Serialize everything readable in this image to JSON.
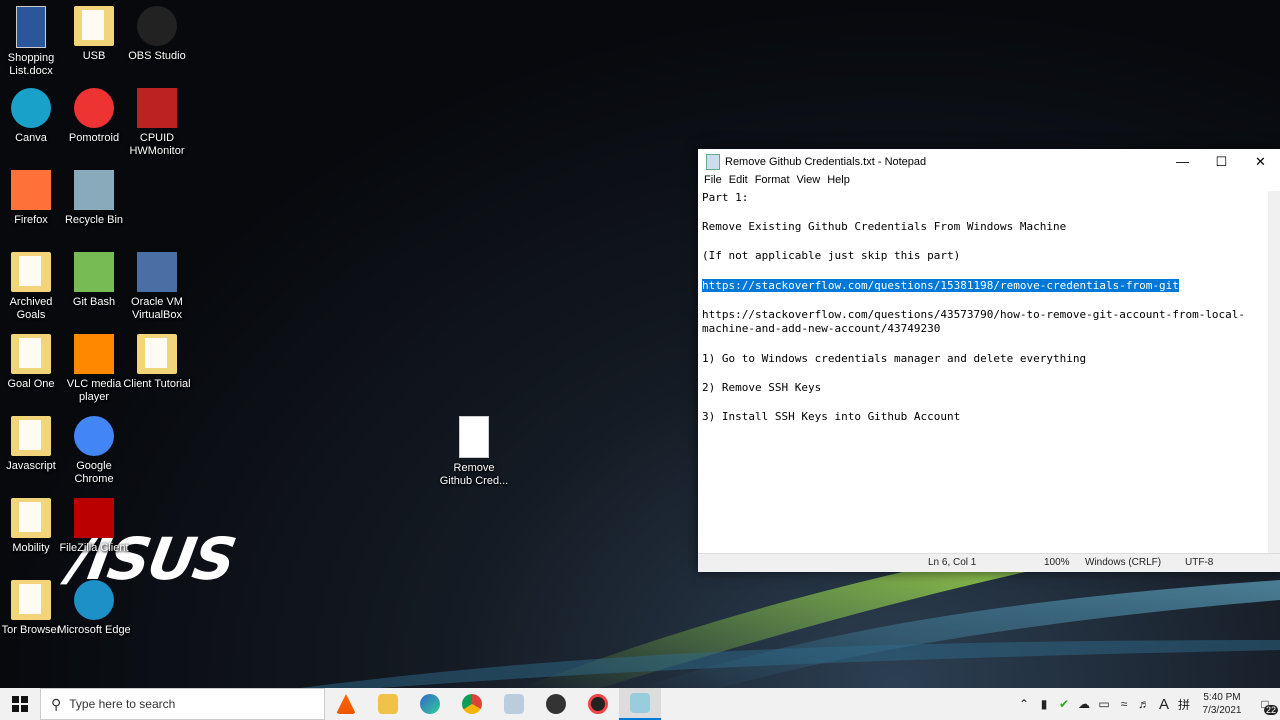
{
  "desktop_icons": [
    {
      "label": "Shopping List.docx"
    },
    {
      "label": "USB"
    },
    {
      "label": "OBS Studio"
    },
    {
      "label": "Canva"
    },
    {
      "label": "Pomotroid"
    },
    {
      "label": "CPUID HWMonitor"
    },
    {
      "label": "Firefox"
    },
    {
      "label": "Recycle Bin"
    },
    {
      "label": "Archived Goals"
    },
    {
      "label": "Git Bash"
    },
    {
      "label": "Oracle VM VirtualBox"
    },
    {
      "label": "Goal One"
    },
    {
      "label": "VLC media player"
    },
    {
      "label": "Client Tutorial"
    },
    {
      "label": "Javascript"
    },
    {
      "label": "Google Chrome"
    },
    {
      "label": "Mobility"
    },
    {
      "label": "FileZilla Client"
    },
    {
      "label": "Tor Browser"
    },
    {
      "label": "Microsoft Edge"
    },
    {
      "label": "Remove Github Cred..."
    }
  ],
  "wallpaper_logo": "/ISUS",
  "notepad": {
    "title": "Remove Github Credentials.txt - Notepad",
    "menu": [
      "File",
      "Edit",
      "Format",
      "View",
      "Help"
    ],
    "lines": [
      "Part 1:",
      "",
      "Remove Existing Github Credentials From Windows Machine",
      "",
      "(If not applicable just skip this part)",
      "",
      "https://stackoverflow.com/questions/15381198/remove-credentials-from-git",
      "",
      "https://stackoverflow.com/questions/43573790/how-to-remove-git-account-from-local-",
      "machine-and-add-new-account/43749230",
      "",
      "1) Go to Windows credentials manager and delete everything",
      "",
      "2) Remove SSH Keys",
      "",
      "3) Install SSH Keys into Github Account"
    ],
    "selected_line": 6,
    "status": {
      "position": "Ln 6, Col 1",
      "zoom": "100%",
      "line_ending": "Windows (CRLF)",
      "encoding": "UTF-8"
    }
  },
  "taskbar": {
    "search_placeholder": "Type here to search",
    "apps": [
      "vlc-icon",
      "file-explorer-icon",
      "edge-icon",
      "chrome-icon",
      "photos-icon",
      "obs-icon",
      "pomotroid-icon",
      "notepad-icon"
    ],
    "time": "5:40 PM",
    "date": "7/3/2021",
    "notification_count": "22",
    "tray_letter": "A",
    "ime_glyph": "拼"
  },
  "colors": {
    "selection": "#0078d7",
    "taskbar": "#f1f1f1"
  }
}
